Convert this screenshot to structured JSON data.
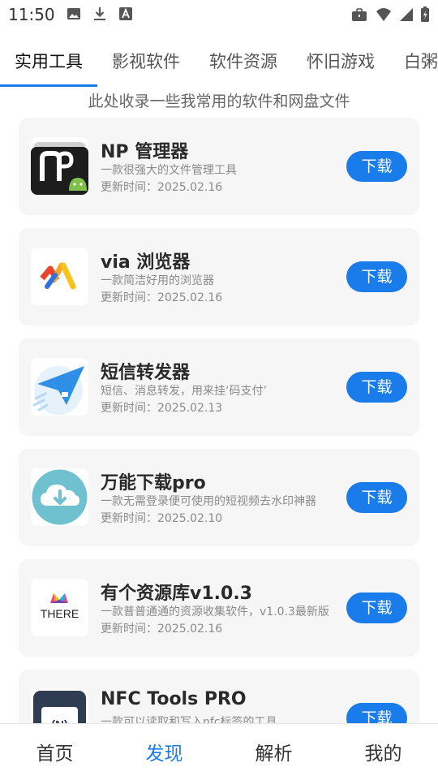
{
  "status_bar": {
    "time": "11:50",
    "left_icons": [
      "image-icon",
      "download-icon",
      "a-icon"
    ],
    "right_icons": [
      "briefcase-icon",
      "wifi-icon",
      "signal-icon",
      "battery-icon"
    ]
  },
  "tabs": [
    {
      "label": "实用工具",
      "active": true
    },
    {
      "label": "影视软件",
      "active": false
    },
    {
      "label": "软件资源",
      "active": false
    },
    {
      "label": "怀旧游戏",
      "active": false
    },
    {
      "label": "白粥",
      "active": false
    }
  ],
  "subtitle": "此处收录一些我常用的软件和网盘文件",
  "apps": [
    {
      "name": "NP 管理器",
      "desc": "一款很强大的文件管理工具",
      "date": "更新时间：2025.02.16",
      "button": "下载",
      "icon": "np-manager-icon"
    },
    {
      "name": "via 浏览器",
      "desc": "一款简洁好用的浏览器",
      "date": "更新时间：2025.02.16",
      "button": "下载",
      "icon": "via-browser-icon"
    },
    {
      "name": "短信转发器",
      "desc": "短信、消息转发，用来挂‘码支付’",
      "date": "更新时间：2025.02.13",
      "button": "下载",
      "icon": "paper-plane-icon"
    },
    {
      "name": "万能下载pro",
      "desc": "一款无需登录便可使用的短视频去水印神器",
      "date": "更新时间：2025.02.10",
      "button": "下载",
      "icon": "cloud-download-icon"
    },
    {
      "name": "有个资源库v1.0.3",
      "desc": "一款普普通通的资源收集软件，v1.0.3最新版",
      "date": "更新时间：2025.02.16",
      "button": "下载",
      "icon": "there-logo-icon",
      "icon_text": "THERE"
    },
    {
      "name": "NFC Tools PRO",
      "desc": "一款可以读取和写入nfc标签的工具",
      "date": "",
      "button": "下载",
      "icon": "nfc-icon",
      "icon_text": "(N)"
    }
  ],
  "bottom_nav": [
    {
      "label": "首页",
      "active": false
    },
    {
      "label": "发现",
      "active": true
    },
    {
      "label": "解析",
      "active": false
    },
    {
      "label": "我的",
      "active": false
    }
  ],
  "colors": {
    "accent": "#1a7bea",
    "card_bg": "#f6f6f6"
  }
}
